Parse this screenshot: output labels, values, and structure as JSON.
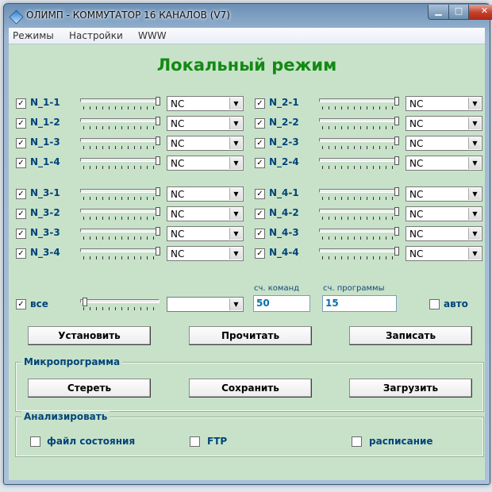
{
  "window": {
    "title": "ОЛИМП - КОММУТАТОР 16 КАНАЛОВ (V7)"
  },
  "menu": [
    "Режимы",
    "Настройки",
    "WWW"
  ],
  "mode_title": "Локальный режим",
  "channels": [
    {
      "label": "N_1-1",
      "checked": true,
      "select": "NC"
    },
    {
      "label": "N_1-2",
      "checked": true,
      "select": "NC"
    },
    {
      "label": "N_1-3",
      "checked": true,
      "select": "NC"
    },
    {
      "label": "N_1-4",
      "checked": true,
      "select": "NC"
    },
    {
      "label": "N_2-1",
      "checked": true,
      "select": "NC"
    },
    {
      "label": "N_2-2",
      "checked": true,
      "select": "NC"
    },
    {
      "label": "N_2-3",
      "checked": true,
      "select": "NC"
    },
    {
      "label": "N_2-4",
      "checked": true,
      "select": "NC"
    },
    {
      "label": "N_3-1",
      "checked": true,
      "select": "NC"
    },
    {
      "label": "N_3-2",
      "checked": true,
      "select": "NC"
    },
    {
      "label": "N_3-3",
      "checked": true,
      "select": "NC"
    },
    {
      "label": "N_3-4",
      "checked": true,
      "select": "NC"
    },
    {
      "label": "N_4-1",
      "checked": true,
      "select": "NC"
    },
    {
      "label": "N_4-2",
      "checked": true,
      "select": "NC"
    },
    {
      "label": "N_4-3",
      "checked": true,
      "select": "NC"
    },
    {
      "label": "N_4-4",
      "checked": true,
      "select": "NC"
    }
  ],
  "all": {
    "label": "все",
    "checked": true,
    "select": ""
  },
  "cmd_counter": {
    "label": "сч. команд",
    "value": "50"
  },
  "prog_counter": {
    "label": "сч. программы",
    "value": "15"
  },
  "auto": {
    "label": "авто",
    "checked": false
  },
  "buttons": {
    "set": "Установить",
    "read": "Прочитать",
    "write": "Записать"
  },
  "firmware": {
    "title": "Микропрограмма",
    "erase": "Стереть",
    "save": "Сохранить",
    "load": "Загрузить"
  },
  "analyze": {
    "title": "Анализировать",
    "state_file": "файл состояния",
    "ftp": "FTP",
    "schedule": "расписание"
  }
}
